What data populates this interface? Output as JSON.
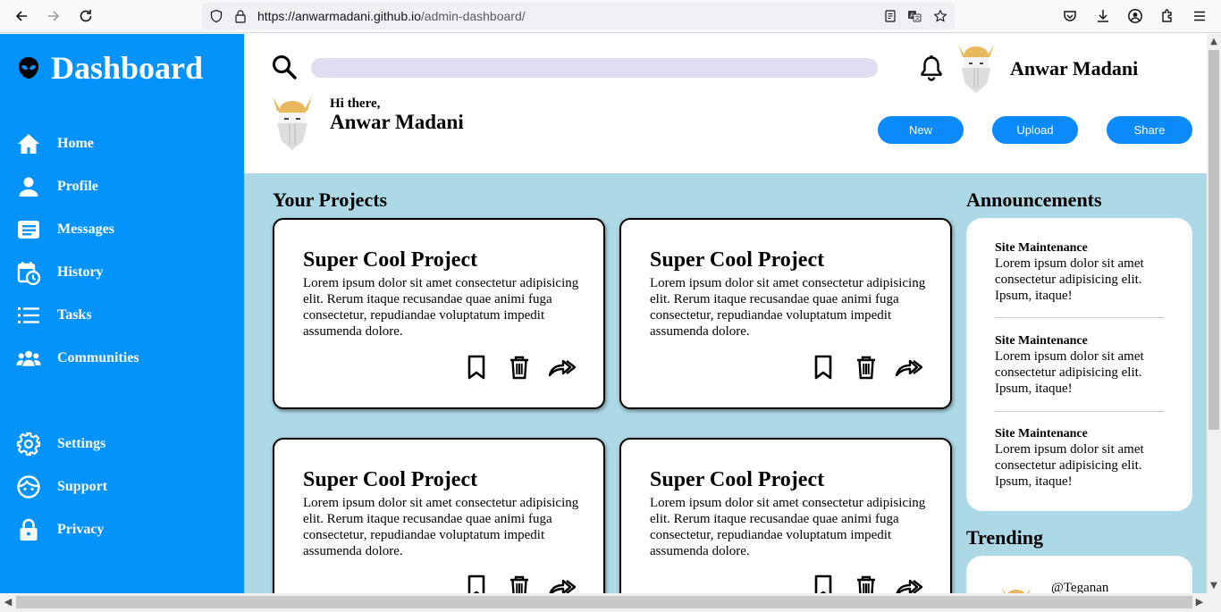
{
  "browser": {
    "url_host": "https://anwarmadani.github.io",
    "url_path": "/admin-dashboard/"
  },
  "sidebar": {
    "title": "Dashboard",
    "items": [
      {
        "label": "Home",
        "icon": "home-icon"
      },
      {
        "label": "Profile",
        "icon": "user-icon"
      },
      {
        "label": "Messages",
        "icon": "messages-icon"
      },
      {
        "label": "History",
        "icon": "history-icon"
      },
      {
        "label": "Tasks",
        "icon": "tasks-icon"
      },
      {
        "label": "Communities",
        "icon": "communities-icon"
      }
    ],
    "bottom_items": [
      {
        "label": "Settings",
        "icon": "gear-icon"
      },
      {
        "label": "Support",
        "icon": "support-icon"
      },
      {
        "label": "Privacy",
        "icon": "lock-icon"
      }
    ]
  },
  "header": {
    "search_placeholder": "",
    "user_name": "Anwar Madani",
    "greeting": "Hi there,",
    "greeting_name": "Anwar Madani",
    "buttons": {
      "new": "New",
      "upload": "Upload",
      "share": "Share"
    }
  },
  "projects": {
    "title": "Your Projects",
    "cards": [
      {
        "title": "Super Cool Project",
        "text": "Lorem ipsum dolor sit amet consectetur adipisicing elit. Rerum itaque recusandae quae animi fuga consectetur, repudiandae voluptatum impedit assumenda dolore."
      },
      {
        "title": "Super Cool Project",
        "text": "Lorem ipsum dolor sit amet consectetur adipisicing elit. Rerum itaque recusandae quae animi fuga consectetur, repudiandae voluptatum impedit assumenda dolore."
      },
      {
        "title": "Super Cool Project",
        "text": "Lorem ipsum dolor sit amet consectetur adipisicing elit. Rerum itaque recusandae quae animi fuga consectetur, repudiandae voluptatum impedit assumenda dolore."
      },
      {
        "title": "Super Cool Project",
        "text": "Lorem ipsum dolor sit amet consectetur adipisicing elit. Rerum itaque recusandae quae animi fuga consectetur, repudiandae voluptatum impedit assumenda dolore."
      }
    ]
  },
  "announcements": {
    "title": "Announcements",
    "items": [
      {
        "title": "Site Maintenance",
        "text": "Lorem ipsum dolor sit amet consectetur adipisicing elit. Ipsum, itaque!"
      },
      {
        "title": "Site Maintenance",
        "text": "Lorem ipsum dolor sit amet consectetur adipisicing elit. Ipsum, itaque!"
      },
      {
        "title": "Site Maintenance",
        "text": "Lorem ipsum dolor sit amet consectetur adipisicing elit. Ipsum, itaque!"
      }
    ]
  },
  "trending": {
    "title": "Trending",
    "users": [
      {
        "handle": "@Teganan"
      }
    ]
  },
  "colors": {
    "sidebar": "#0493fb",
    "main_bg": "#add8e6",
    "button": "#0a8afb",
    "search": "#e2dcf2"
  }
}
